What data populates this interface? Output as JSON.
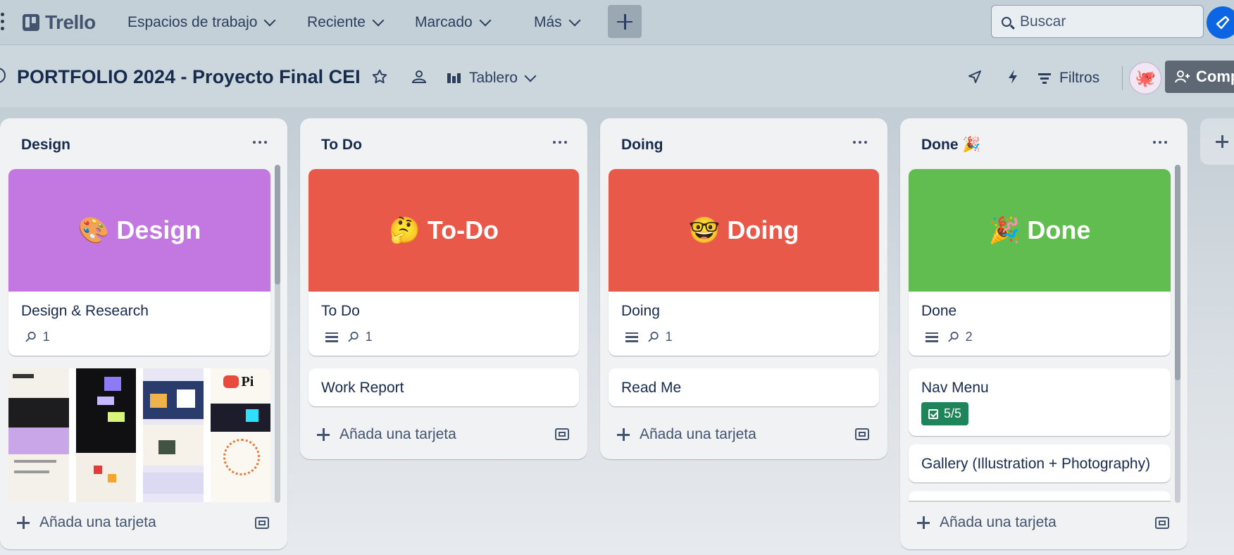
{
  "topbar": {
    "app_name": "Trello",
    "menus": [
      {
        "label": "Espacios de trabajo"
      },
      {
        "label": "Reciente"
      },
      {
        "label": "Marcado"
      },
      {
        "label": "Más"
      }
    ],
    "search_placeholder": "Buscar"
  },
  "board": {
    "title": "PORTFOLIO 2024 - Proyecto Final CEI",
    "view_label": "Tablero",
    "filter_label": "Filtros",
    "share_label": "Comp"
  },
  "add_card_label": "Añada una tarjeta",
  "lists": [
    {
      "title": "Design",
      "cover_label": "Design",
      "cover_emoji": "🎨",
      "cover_color": "#c377e0",
      "card_title": "Design & Research",
      "attachments": "1"
    },
    {
      "title": "To Do",
      "cover_label": "To-Do",
      "cover_emoji": "🤔",
      "cover_color": "#e8594a",
      "card_title": "To Do",
      "attachments": "1",
      "extra_card": "Work Report"
    },
    {
      "title": "Doing",
      "cover_label": "Doing",
      "cover_emoji": "🤓",
      "cover_color": "#e8594a",
      "card_title": "Doing",
      "attachments": "1",
      "extra_card": "Read Me"
    },
    {
      "title": "Done",
      "title_emoji": "🎉",
      "cover_label": "Done",
      "cover_emoji": "🎉",
      "cover_color": "#61bd4f",
      "card_title": "Done",
      "attachments": "2",
      "extra_card": "Nav Menu",
      "checklist": "5/5",
      "extra_card_2": "Gallery (Illustration + Photography)"
    }
  ],
  "colors": {
    "checklist_complete": "#1f845a",
    "primary_blue": "#0c66e4"
  }
}
